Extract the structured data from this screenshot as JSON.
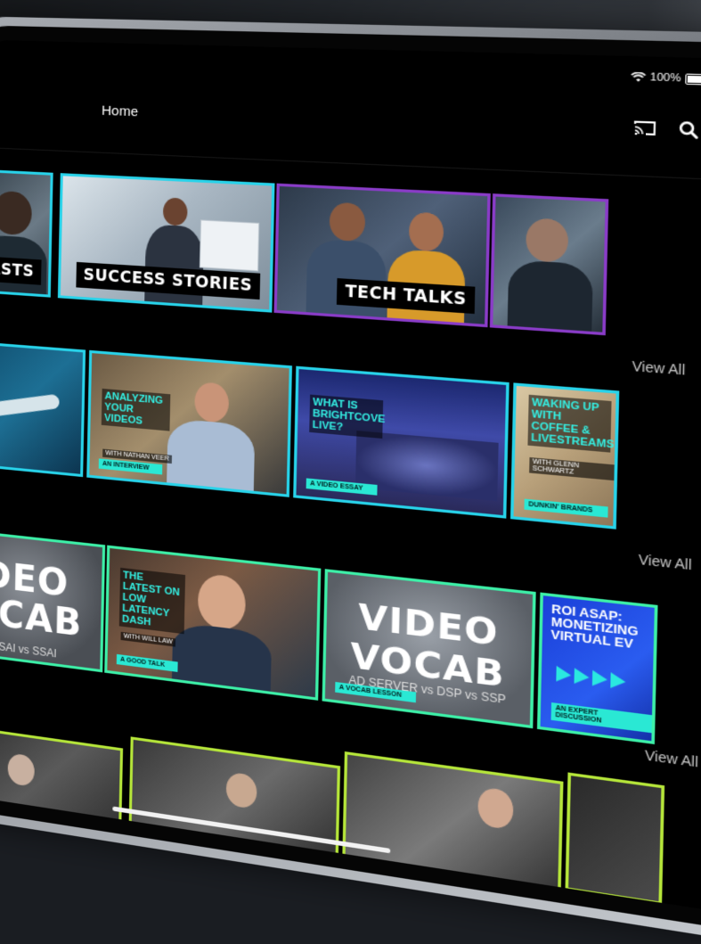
{
  "status_bar": {
    "battery": "100%"
  },
  "nav": {
    "home": "Home"
  },
  "categories": [
    {
      "label": "DCASTS"
    },
    {
      "label": "SUCCESS STORIES"
    },
    {
      "label": "TECH TALKS"
    },
    {
      "label": ""
    }
  ],
  "row2": {
    "view_all": "View All",
    "items": [
      {
        "title": "",
        "byline": "",
        "tag": ""
      },
      {
        "title": "ANALYZING YOUR VIDEOS",
        "byline": "WITH NATHAN VEER",
        "tag": "AN INTERVIEW"
      },
      {
        "title": "WHAT IS BRIGHTCOVE LIVE?",
        "byline": "",
        "tag": "A VIDEO ESSAY"
      },
      {
        "title": "WAKING UP WITH COFFEE & LIVESTREAMS",
        "byline": "WITH GLENN SCHWARTZ",
        "tag": "DUNKIN' BRANDS"
      }
    ]
  },
  "row3": {
    "view_all": "View All",
    "items": [
      {
        "big": "DEO\nOCAB",
        "sub": "CSAI vs SSAI",
        "title": "",
        "byline": "",
        "tag": ""
      },
      {
        "big": "",
        "sub": "",
        "title": "THE LATEST ON LOW LATENCY DASH",
        "byline": "WITH WILL LAW",
        "tag": "A GOOD TALK"
      },
      {
        "big": "VIDEO\nVOCAB",
        "sub": "AD SERVER vs DSP vs SSP",
        "title": "",
        "byline": "",
        "tag": "A VOCAB LESSON"
      },
      {
        "big": "ROI ASAP:\nMONETIZING\nVIRTUAL EV",
        "sub": "",
        "title": "",
        "byline": "",
        "tag": "AN EXPERT DISCUSSION"
      }
    ]
  },
  "row4": {
    "view_all": "View All"
  },
  "colors": {
    "card_border_cyan": "#28d3ea",
    "card_border_purple": "#8a3cc8",
    "card_border_green": "#3df0a8",
    "card_border_lime": "#b6e63a",
    "accent_teal": "#34f0e4"
  },
  "icons": [
    "wifi-icon",
    "battery-icon",
    "cast-icon",
    "search-icon"
  ]
}
